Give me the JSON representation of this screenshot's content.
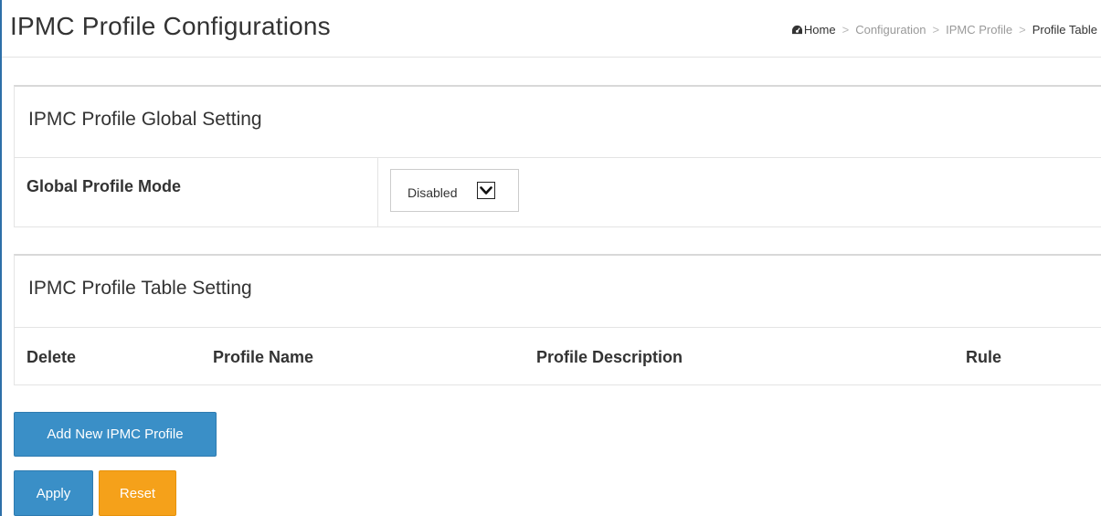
{
  "header": {
    "title": "IPMC Profile Configurations",
    "breadcrumb": {
      "home_icon": "dashboard-icon",
      "items": [
        "Home",
        "Configuration",
        "IPMC Profile",
        "Profile Table"
      ],
      "separator": ">"
    }
  },
  "global_setting": {
    "heading": "IPMC Profile Global Setting",
    "mode_label": "Global Profile Mode",
    "mode_value": "Disabled"
  },
  "table_setting": {
    "heading": "IPMC Profile Table Setting",
    "columns": [
      "Delete",
      "Profile Name",
      "Profile Description",
      "Rule"
    ]
  },
  "buttons": {
    "add_label": "Add New IPMC Profile",
    "apply_label": "Apply",
    "reset_label": "Reset"
  },
  "colors": {
    "accent_blue": "#3a8fc7",
    "accent_orange": "#f5a11a",
    "left_border": "#2d6fa8"
  }
}
